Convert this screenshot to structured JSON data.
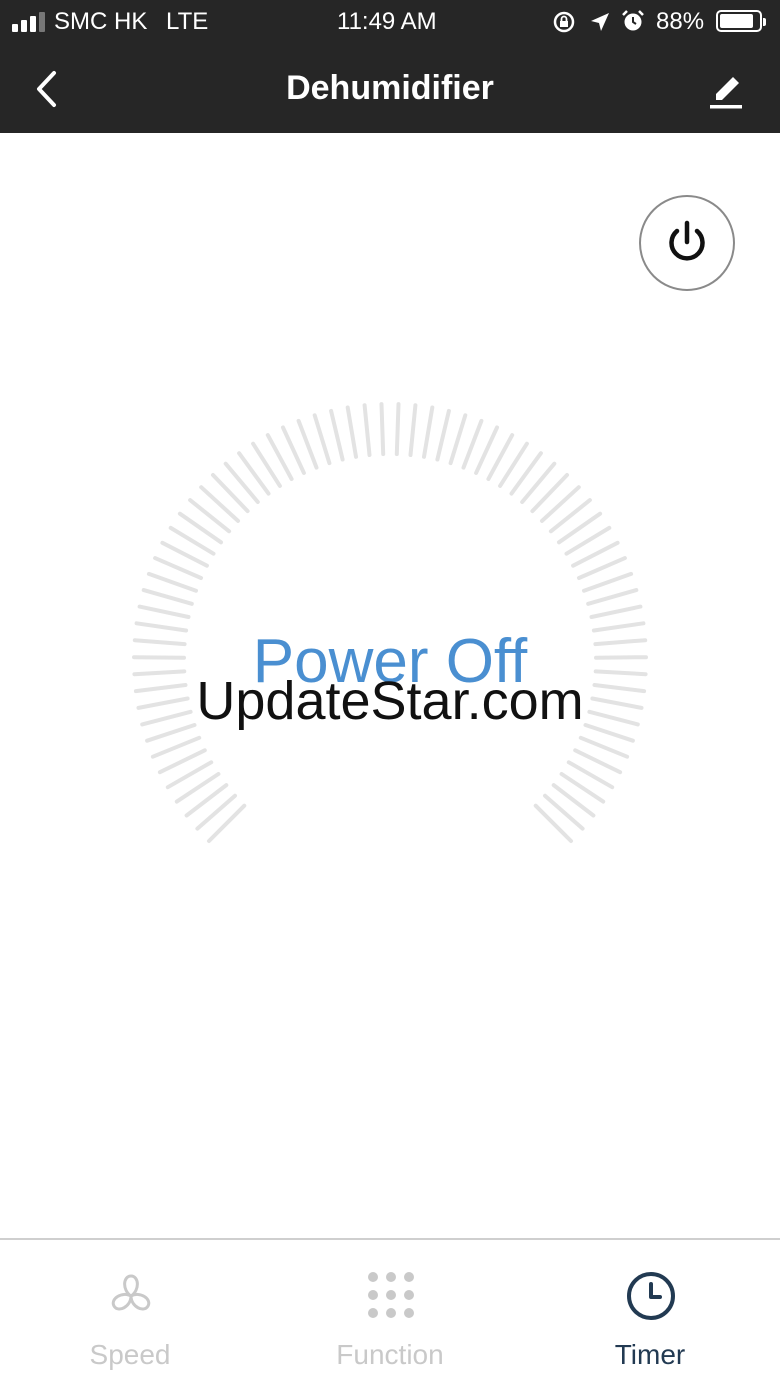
{
  "status_bar": {
    "carrier": "SMC HK",
    "network": "LTE",
    "time": "11:49 AM",
    "battery": "88%",
    "battery_level": 0.88
  },
  "header": {
    "title": "Dehumidifier",
    "back_icon": "chevron-left-icon",
    "edit_icon": "pencil-icon"
  },
  "main": {
    "power_icon": "power-icon",
    "status": "Power Off",
    "watermark": "UpdateStar.com"
  },
  "tabs": [
    {
      "label": "Speed",
      "icon": "fan-icon",
      "active": false
    },
    {
      "label": "Function",
      "icon": "grid-dots-icon",
      "active": false
    },
    {
      "label": "Timer",
      "icon": "clock-icon",
      "active": true
    }
  ],
  "colors": {
    "header_bg": "#262626",
    "status_text": "#4a8fd1",
    "tab_active": "#223a52",
    "tab_inactive": "#c9c9c9",
    "tick": "#e3e3e3"
  }
}
